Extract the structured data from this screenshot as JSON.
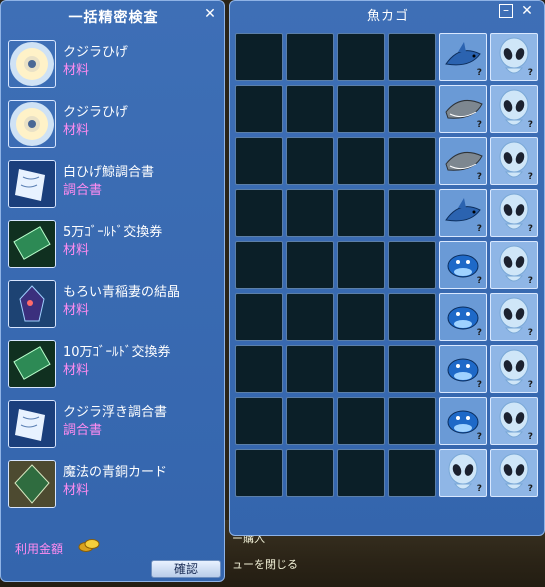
{
  "left_window": {
    "title": "一括精密検査",
    "items": [
      {
        "name": "クジラひげ",
        "type": "材料",
        "icon": "whale-whisker-icon"
      },
      {
        "name": "クジラひげ",
        "type": "材料",
        "icon": "whale-whisker-icon"
      },
      {
        "name": "白ひげ鯨調合書",
        "type": "調合書",
        "icon": "scroll-icon"
      },
      {
        "name": "5万ｺﾞｰﾙﾄﾞ交換券",
        "type": "材料",
        "icon": "gold-ticket-icon"
      },
      {
        "name": "もろい青稲妻の結晶",
        "type": "材料",
        "icon": "blue-crystal-icon"
      },
      {
        "name": "10万ｺﾞｰﾙﾄﾞ交換券",
        "type": "材料",
        "icon": "gold-ticket-icon"
      },
      {
        "name": "クジラ浮き調合書",
        "type": "調合書",
        "icon": "scroll-icon"
      },
      {
        "name": "魔法の青銅カード",
        "type": "材料",
        "icon": "bronze-card-icon"
      }
    ],
    "fee_label": "利用金額",
    "confirm_label": "確認"
  },
  "right_window": {
    "title": "魚カゴ",
    "rows": [
      [
        "empty",
        "empty",
        "empty",
        "empty",
        "fish-shark",
        "alien"
      ],
      [
        "empty",
        "empty",
        "empty",
        "empty",
        "fish-whale",
        "alien"
      ],
      [
        "empty",
        "empty",
        "empty",
        "empty",
        "fish-whale",
        "alien"
      ],
      [
        "empty",
        "empty",
        "empty",
        "empty",
        "fish-shark",
        "alien"
      ],
      [
        "empty",
        "empty",
        "empty",
        "empty",
        "fish-dolphin",
        "alien"
      ],
      [
        "empty",
        "empty",
        "empty",
        "empty",
        "fish-dolphin",
        "alien"
      ],
      [
        "empty",
        "empty",
        "empty",
        "empty",
        "fish-dolphin",
        "alien"
      ],
      [
        "empty",
        "empty",
        "empty",
        "empty",
        "fish-dolphin",
        "alien"
      ],
      [
        "empty",
        "empty",
        "empty",
        "empty",
        "alien",
        "alien"
      ]
    ],
    "unknown_mark": "?"
  },
  "background": {
    "line1": "ー購入",
    "line2": "ューを閉じる"
  },
  "colors": {
    "window_blue": "#3a6ab2",
    "item_type_pink": "#ff8cf0",
    "cell_dark": "#0b1f28"
  }
}
